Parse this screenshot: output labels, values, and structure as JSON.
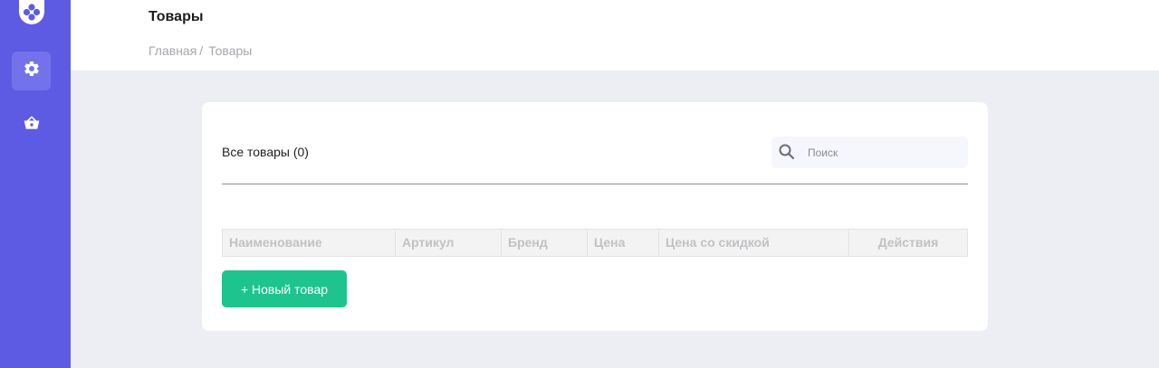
{
  "sidebar": {
    "logo_icon": "logo-icon",
    "items": [
      {
        "icon": "gear-icon",
        "active": true
      },
      {
        "icon": "basket-icon",
        "active": false
      }
    ]
  },
  "header": {
    "title": "Товары",
    "breadcrumb": {
      "home": "Главная",
      "separator": "/",
      "current": "Товары"
    }
  },
  "products": {
    "title": "Все товары (0)",
    "search_placeholder": "Поиск",
    "search_value": "",
    "columns": [
      "Наименование",
      "Артикул",
      "Бренд",
      "Цена",
      "Цена со скидкой",
      "Действия"
    ],
    "rows": [],
    "new_button_label": "+ Новый товар"
  },
  "colors": {
    "sidebar": "#5d5be3",
    "accent_button": "#1ec48d",
    "background": "#edeef3"
  }
}
